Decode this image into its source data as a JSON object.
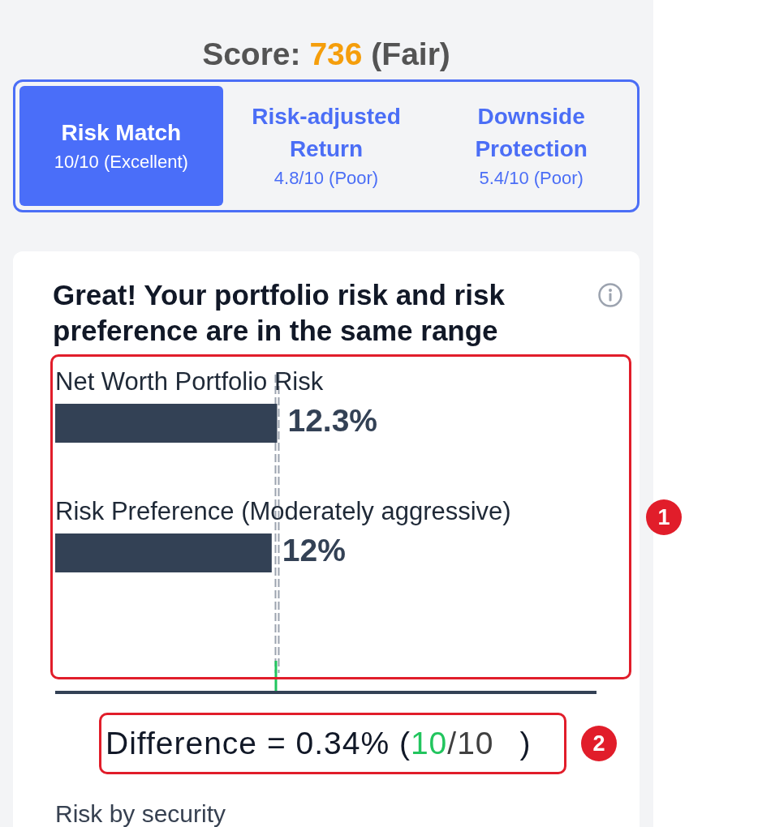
{
  "score": {
    "label": "Score:",
    "value": "736",
    "rating": "(Fair)"
  },
  "tabs": [
    {
      "label": "Risk Match",
      "detail": "10/10 (Excellent)",
      "selected": true
    },
    {
      "label": "Risk-adjusted Return",
      "detail": "4.8/10 (Poor)",
      "selected": false
    },
    {
      "label": "Downside Protection",
      "detail": "5.4/10 (Poor)",
      "selected": false
    }
  ],
  "card": {
    "heading": "Great! Your portfolio risk and risk preference are in the same range",
    "chart": {
      "chart_data": {
        "type": "bar",
        "orientation": "horizontal",
        "categories": [
          "Net Worth Portfolio Risk",
          "Risk Preference (Moderately aggressive)"
        ],
        "values": [
          12.3,
          12
        ],
        "value_labels": [
          "12.3%",
          "12%"
        ]
      }
    },
    "difference": {
      "prefix": "Difference = 0.34% (",
      "score": "10",
      "total": "/10",
      "suffix": ")"
    },
    "section_title": "Risk by security"
  },
  "callouts": [
    {
      "label": "1"
    },
    {
      "label": "2"
    }
  ]
}
